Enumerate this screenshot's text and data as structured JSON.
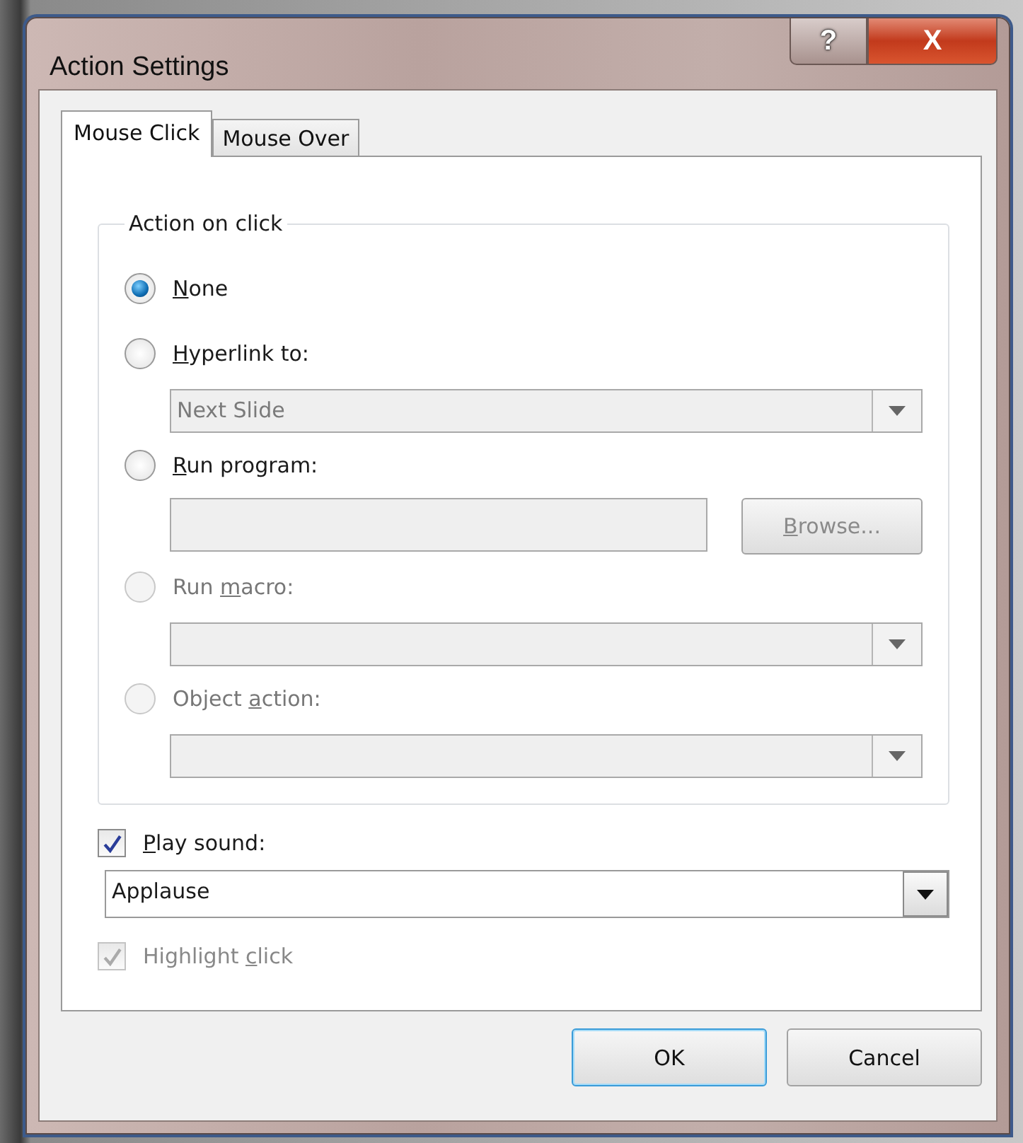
{
  "window": {
    "title": "Action Settings",
    "controls": [
      {
        "kind": "help",
        "label": "?"
      },
      {
        "kind": "close",
        "label": "X"
      }
    ]
  },
  "tabs": [
    {
      "label": "Mouse Click",
      "selected": true
    },
    {
      "label": "Mouse Over",
      "selected": false
    }
  ],
  "action_group": {
    "title": "Action on click",
    "options": [
      {
        "label": [
          {
            "text": "N",
            "underlined": true
          },
          {
            "text": "one",
            "underlined": false
          }
        ],
        "selected": true,
        "disabled": false
      },
      {
        "label": [
          {
            "text": "H",
            "underlined": true
          },
          {
            "text": "yperlink to:",
            "underlined": false
          }
        ],
        "selected": false,
        "disabled": false,
        "control": {
          "kind": "dropdown",
          "value": "Next Slide",
          "disabled": true
        }
      },
      {
        "label": [
          {
            "text": "R",
            "underlined": true
          },
          {
            "text": "un program:",
            "underlined": false
          }
        ],
        "selected": false,
        "disabled": false,
        "control": {
          "kind": "path",
          "disabled": true,
          "button": {
            "label": [
              {
                "text": "B",
                "underlined": true
              },
              {
                "text": "rowse...",
                "underlined": false
              }
            ],
            "disabled": true
          }
        }
      },
      {
        "label": [
          {
            "text": "Run ",
            "underlined": false
          },
          {
            "text": "m",
            "underlined": true
          },
          {
            "text": "acro:",
            "underlined": false
          }
        ],
        "selected": false,
        "disabled": true,
        "control": {
          "kind": "dropdown",
          "disabled": true
        }
      },
      {
        "label": [
          {
            "text": "Object ",
            "underlined": false
          },
          {
            "text": "a",
            "underlined": true
          },
          {
            "text": "ction:",
            "underlined": false
          }
        ],
        "selected": false,
        "disabled": true,
        "control": {
          "kind": "dropdown",
          "disabled": true
        }
      }
    ]
  },
  "play_sound": {
    "label": [
      {
        "text": "P",
        "underlined": true
      },
      {
        "text": "lay sound:",
        "underlined": false
      }
    ],
    "checked": true,
    "disabled": false,
    "value": "Applause"
  },
  "highlight_click": {
    "label": [
      {
        "text": "Highlight ",
        "underlined": false
      },
      {
        "text": "c",
        "underlined": true
      },
      {
        "text": "lick",
        "underlined": false
      }
    ],
    "checked": true,
    "disabled": true
  },
  "buttons": [
    {
      "label": "OK",
      "default": true
    },
    {
      "label": "Cancel",
      "default": false
    }
  ]
}
